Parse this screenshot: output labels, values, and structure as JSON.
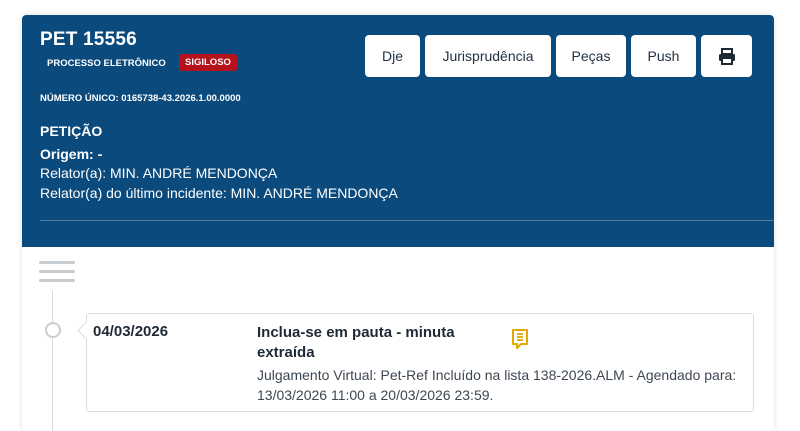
{
  "header": {
    "title": "PET 15556",
    "processo_label": "PROCESSO ELETRÔNICO",
    "badge": "SIGILOSO",
    "numero_label": "NÚMERO ÚNICO:",
    "numero_value": "0165738-43.2026.1.00.0000",
    "classe": "PETIÇÃO",
    "origem": "Origem:  -",
    "relator": "Relator(a): MIN. ANDRÉ MENDONÇA",
    "relator_incidente": "Relator(a) do último incidente: MIN. ANDRÉ MENDONÇA"
  },
  "toolbar": {
    "dje": "Dje",
    "jurisprudencia": "Jurisprudência",
    "pecas": "Peças",
    "push": "Push",
    "print_icon": "printer-icon"
  },
  "colors": {
    "header_bg": "#0b4a7d",
    "badge_bg": "#b5121b",
    "note_icon": "#e0a800"
  },
  "events": [
    {
      "date": "04/03/2026",
      "title": "Inclua-se em pauta - minuta extraída",
      "description": "Julgamento Virtual: Pet-Ref Incluído na lista 138-2026.ALM - Agendado para: 13/03/2026 11:00 a 20/03/2026 23:59.",
      "icon": "note-icon"
    }
  ]
}
